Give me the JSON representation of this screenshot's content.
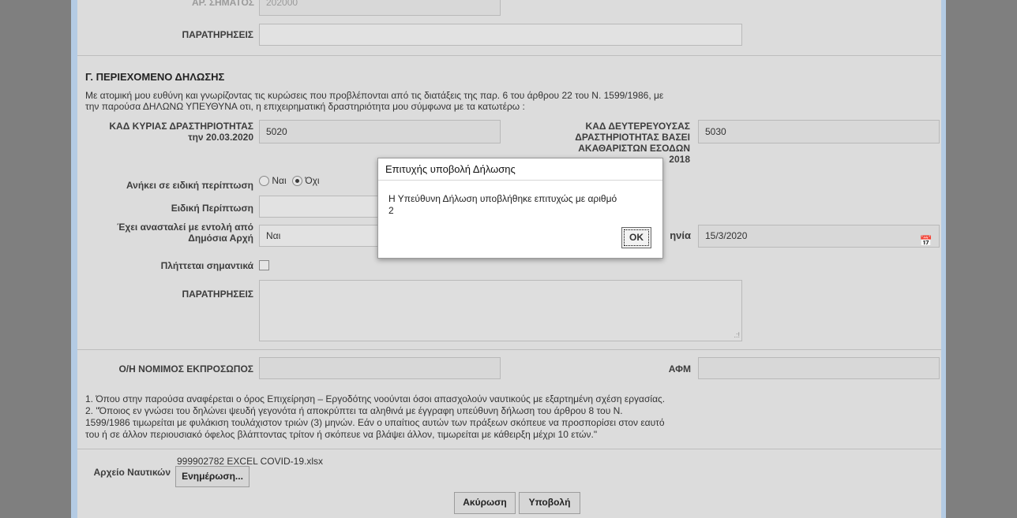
{
  "top": {
    "cut_label": "ΑΡ. ΣΗΜΑΤΟΣ",
    "cut_value": "202000"
  },
  "notes_label": "ΠΑΡΑΤΗΡΗΣΕΙΣ",
  "section": {
    "title": "Γ. ΠΕΡΙΕΧΟΜΕΝΟ ΔΗΛΩΣΗΣ",
    "intro_line1": "Με ατομική μου ευθύνη και γνωρίζοντας τις κυρώσεις που προβλέπονται από τις διατάξεις της παρ. 6 του άρθρου 22 του Ν. 1599/1986, με",
    "intro_line2": "την παρούσα ΔΗΛΩΝΩ ΥΠΕΥΘΥΝΑ οτι, η επιχειρηματική δραστηριότητα μου σύμφωνα με τα κατωτέρω :",
    "kad_main_label_1": "ΚΑΔ ΚΥΡΙΑΣ ΔΡΑΣΤΗΡΙΟΤΗΤΑΣ",
    "kad_main_label_2": "την 20.03.2020",
    "kad_main_value": "5020",
    "kad_sec_label_1": "ΚΑΔ ΔΕΥΤΕΡΕΥΟΥΣΑΣ",
    "kad_sec_label_2": "ΔΡΑΣΤΗΡΙΟΤΗΤΑΣ ΒΑΣΕΙ",
    "kad_sec_label_3": "ΑΚΑΘΑΡΙΣΤΩΝ ΕΣΟΔΩΝ",
    "kad_sec_label_4": "2018",
    "kad_sec_value": "5030",
    "special_case_label": "Ανήκει σε ειδική περίπτωση",
    "radio_yes": "Ναι",
    "radio_no": "Όχι",
    "special_case_field_label": "Ειδική Περίπτωση",
    "suspended_label_1": "Έχει ανασταλεί με εντολή από",
    "suspended_label_2": "Δημόσια Αρχή",
    "suspended_value": "Ναι",
    "date_label_tail": "ηνία",
    "date_value": "15/3/2020",
    "affected_label": "Πλήττεται σημαντικά",
    "notes_label": "ΠΑΡΑΤΗΡΗΣΕΙΣ"
  },
  "representative": {
    "label": "Ο/Η ΝΟΜΙΜΟΣ ΕΚΠΡΟΣΩΠΟΣ",
    "afm_label": "ΑΦΜ"
  },
  "footnotes": {
    "line1": "1. Όπου στην παρούσα αναφέρεται ο όρος Επιχείρηση – Εργοδότης νοούνται όσοι απασχολούν ναυτικούς με εξαρτημένη σχέση εργασίας.",
    "line2": "2. \"Όποιος εν γνώσει του δηλώνει ψευδή γεγονότα ή αποκρύπτει τα αληθινά με έγγραφη υπεύθυνη δήλωση του άρθρου 8 του Ν.",
    "line3": "1599/1986 τιμωρείται με φυλάκιση τουλάχιστον τριών (3) μηνών. Εάν ο υπαίτιος αυτών των πράξεων σκόπευε να προσπορίσει στον εαυτό",
    "line4": "του ή σε άλλον περιουσιακό όφελος βλάπτοντας τρίτον ή σκόπευε να βλάψει άλλον, τιμωρείται με κάθειρξη μέχρι 10 ετών.\""
  },
  "file": {
    "label": "Αρχείο Ναυτικών",
    "filename": "999902782 EXCEL COVID-19.xlsx",
    "update_button": "Ενημέρωση..."
  },
  "actions": {
    "cancel": "Ακύρωση",
    "submit": "Υποβολή"
  },
  "dialog": {
    "title": "Επιτυχής υποβολή Δήλωσης",
    "message_line1": "Η Υπεύθυνη Δήλωση υποβλήθηκε επιτυχώς με αριθμό",
    "message_line2": "2",
    "ok": "OK"
  }
}
